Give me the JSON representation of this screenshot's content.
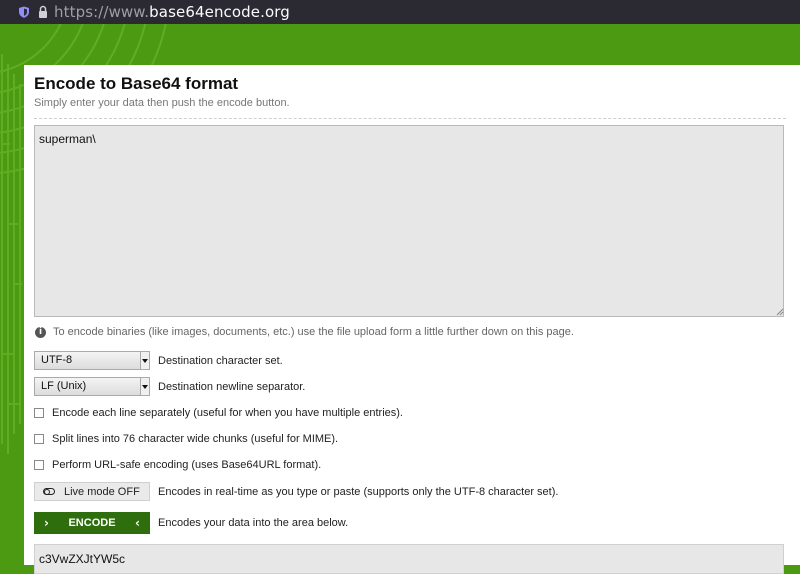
{
  "browser": {
    "url_scheme": "https://www.",
    "url_host": "base64encode.org",
    "icons": [
      "shield-icon",
      "lock-icon"
    ]
  },
  "colors": {
    "background_green": "#4c9a12",
    "button_green": "#2f6e0d",
    "panel": "#ffffff",
    "input_bg": "#e7e7e7"
  },
  "header": {
    "title": "Encode to Base64 format",
    "subtitle": "Simply enter your data then push the encode button."
  },
  "input": {
    "value": "superman\\"
  },
  "info": {
    "icon": "info-icon",
    "text": "To encode binaries (like images, documents, etc.) use the file upload form a little further down on this page."
  },
  "options": {
    "charset": {
      "selected": "UTF-8",
      "label": "Destination character set."
    },
    "newline": {
      "selected": "LF (Unix)",
      "label": "Destination newline separator."
    },
    "checkboxes": [
      {
        "label": "Encode each line separately (useful for when you have multiple entries).",
        "checked": false
      },
      {
        "label": "Split lines into 76 character wide chunks (useful for MIME).",
        "checked": false
      },
      {
        "label": "Perform URL-safe encoding (uses Base64URL format).",
        "checked": false
      }
    ]
  },
  "live_mode": {
    "button_label": "Live mode OFF",
    "description": "Encodes in real-time as you type or paste (supports only the UTF-8 character set)."
  },
  "encode": {
    "button_label": "ENCODE",
    "description": "Encodes your data into the area below."
  },
  "output": {
    "value": "c3VwZXJtYW5c"
  }
}
